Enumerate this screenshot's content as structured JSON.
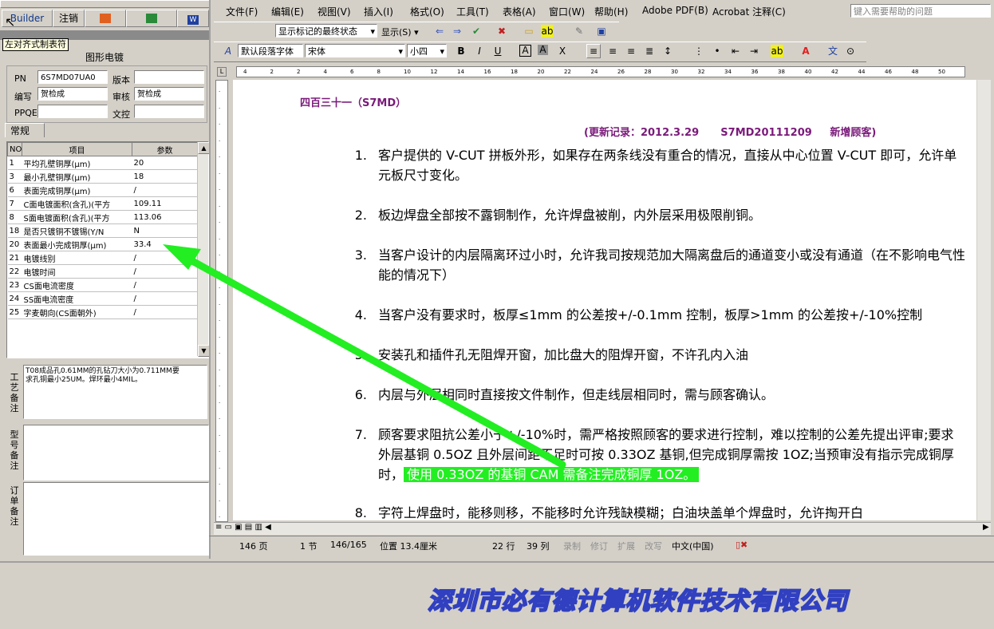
{
  "left_panel": {
    "top_buttons": {
      "builder": "Builder",
      "cancel": "注销"
    },
    "tooltip": "左对齐式制表符",
    "panel_title": "图形电镀",
    "fields": {
      "pn_label": "PN",
      "pn_value": "6S7MD07UA0",
      "version_label": "版本",
      "version_value": "",
      "author_label": "编写",
      "author_value": "贺检成",
      "review_label": "审核",
      "review_value": "贺检成",
      "ppqe_label": "PPQE",
      "ppqe_value": "",
      "control_label": "文控",
      "control_value": ""
    },
    "tab": "常规",
    "table_headers": {
      "no": "NO",
      "item": "项目",
      "param": "参数"
    },
    "rows": [
      {
        "no": "1",
        "item": "平均孔壁铜厚(μm)",
        "param": "20"
      },
      {
        "no": "3",
        "item": "最小孔壁铜厚(μm)",
        "param": "18"
      },
      {
        "no": "6",
        "item": "表面完成铜厚(μm)",
        "param": "/"
      },
      {
        "no": "7",
        "item": "C面电镀面积(含孔)(平方",
        "param": "109.11"
      },
      {
        "no": "8",
        "item": "S面电镀面积(含孔)(平方",
        "param": "113.06"
      },
      {
        "no": "18",
        "item": "是否只镀铜不镀锡(Y/N",
        "param": "N"
      },
      {
        "no": "20",
        "item": "表面最小完成铜厚(μm)",
        "param": "33.4"
      },
      {
        "no": "21",
        "item": "电镀线别",
        "param": "/"
      },
      {
        "no": "22",
        "item": "电镀时间",
        "param": "/"
      },
      {
        "no": "23",
        "item": "CS面电流密度",
        "param": "/"
      },
      {
        "no": "24",
        "item": "SS面电流密度",
        "param": "/"
      },
      {
        "no": "25",
        "item": "字麦朝向(CS面朝外)",
        "param": "/"
      }
    ],
    "process_note_label": "工艺备注",
    "process_note": "T08成品孔0.61MM的孔钻刀大小为0.711MM要求孔铜最小25UM。焊环最小4MIL。",
    "model_note_label": "型号备注",
    "order_note_label": "订单备注"
  },
  "word": {
    "menu": [
      "文件(F)",
      "编辑(E)",
      "视图(V)",
      "插入(I)",
      "格式(O)",
      "工具(T)",
      "表格(A)",
      "窗口(W)",
      "帮助(H)",
      "Adobe PDF(B)",
      "Acrobat 注释(C)"
    ],
    "help_box": "键入需要帮助的问题",
    "review_dropdown": "显示标记的最终状态",
    "show_button": "显示(S)",
    "style_dropdown": "默认段落字体",
    "font_dropdown": "宋体",
    "size_dropdown": "小四",
    "ruler_numbers": [
      "4",
      "2",
      "2",
      "4",
      "6",
      "8",
      "10",
      "12",
      "14",
      "16",
      "18",
      "20",
      "22",
      "24",
      "26",
      "28",
      "30",
      "32",
      "34",
      "36",
      "38",
      "40",
      "42",
      "44",
      "46",
      "48",
      "50"
    ],
    "doc": {
      "heading": "四百三十一（S7MD）",
      "update": "(更新记录：2012.3.29      S7MD20111209     新增顾客)",
      "items": [
        {
          "n": "1.",
          "text": "客户提供的 V-CUT 拼板外形，如果存在两条线没有重合的情况，直接从中心位置 V-CUT 即可，允许单元板尺寸变化。"
        },
        {
          "n": "2.",
          "text": "板边焊盘全部按不露铜制作，允许焊盘被削，内外层采用极限削铜。"
        },
        {
          "n": "3.",
          "text": "当客户设计的内层隔离环过小时，允许我司按规范加大隔离盘后的通道变小或没有通道（在不影响电气性能的情况下）"
        },
        {
          "n": "4.",
          "text": "当客户没有要求时，板厚≤1mm 的公差按+/-0.1mm 控制，板厚>1mm 的公差按+/-10%控制"
        },
        {
          "n": "5.",
          "text": "安装孔和插件孔无阻焊开窗，加比盘大的阻焊开窗，不许孔内入油"
        },
        {
          "n": "6.",
          "text": "内层与外层相同时直接按文件制作，但走线层相同时，需与顾客确认。"
        },
        {
          "n": "7.",
          "text": "顾客要求阻抗公差小于+/-10%时，需严格按照顾客的要求进行控制，难以控制的公差先提出评审;要求外层基铜 0.5OZ 且外层间距不足时可按 0.33OZ 基铜,但完成铜厚需按 1OZ;当预审没有指示完成铜厚时，"
        },
        {
          "n": "8.",
          "text": "字符上焊盘时，能移则移，不能移时允许残缺模糊；白油块盖单个焊盘时，允许掏开白"
        }
      ],
      "highlight": "使用 0.33OZ 的基铜 CAM 需备注完成铜厚 1OZ。"
    },
    "status": {
      "page": "146 页",
      "section": "1 节",
      "pages": "146/165",
      "pos": "位置 13.4厘米",
      "line": "22 行",
      "col": "39 列",
      "rec": "录制",
      "rev": "修订",
      "ext": "扩展",
      "ovr": "改写",
      "lang": "中文(中国)"
    }
  },
  "footer_logo": "深圳市必有德计算机软件技术有限公司",
  "colors": {
    "arrow": "#22ee22",
    "heading": "#7a1a7a",
    "highlight": "#22ee22",
    "panel_bg": "#d4d0c8"
  }
}
